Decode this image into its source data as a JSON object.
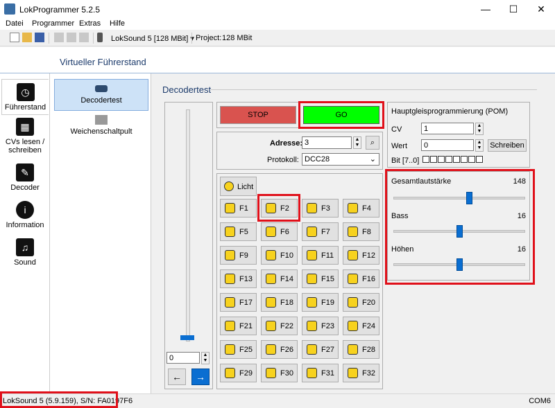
{
  "window": {
    "title": "LokProgrammer 5.2.5",
    "min": "—",
    "max": "☐",
    "close": "✕"
  },
  "menu": [
    "Datei",
    "Programmer",
    "Extras",
    "Hilfe"
  ],
  "toolbar": {
    "device": "LokSound 5 [128 MBit]",
    "project": "Project:",
    "project_value": "128 MBit"
  },
  "header": {
    "title": "Virtueller Führerstand"
  },
  "nav": [
    {
      "label": "Führerstand",
      "icon": "cab-icon"
    },
    {
      "label": "CVs lesen / schreiben",
      "icon": "cv-icon"
    },
    {
      "label": "Decoder",
      "icon": "wrench-icon"
    },
    {
      "label": "Information",
      "icon": "info-icon"
    },
    {
      "label": "Sound",
      "icon": "music-icon"
    }
  ],
  "subnav": [
    {
      "label": "Decodertest"
    },
    {
      "label": "Weichenschaltpult"
    }
  ],
  "section": {
    "title": "Decodertest"
  },
  "control": {
    "stop": "STOP",
    "go": "GO",
    "adresse_label": "Adresse:",
    "adresse": "3",
    "protokoll_label": "Protokoll:",
    "protokoll": "DCC28",
    "licht": "Licht",
    "speed": "0",
    "back_icon": "←",
    "fwd_icon": "→"
  },
  "functions": [
    "F1",
    "F2",
    "F3",
    "F4",
    "F5",
    "F6",
    "F7",
    "F8",
    "F9",
    "F10",
    "F11",
    "F12",
    "F13",
    "F14",
    "F15",
    "F16",
    "F17",
    "F18",
    "F19",
    "F20",
    "F21",
    "F22",
    "F23",
    "F24",
    "F25",
    "F26",
    "F27",
    "F28",
    "F29",
    "F30",
    "F31",
    "F32"
  ],
  "pom": {
    "title": "Hauptgleisprogrammierung (POM)",
    "cv_label": "CV",
    "cv": "1",
    "wert_label": "Wert",
    "wert": "0",
    "schreiben": "Schreiben",
    "bit_label": "Bit [7..0]"
  },
  "volume": {
    "gesamt_label": "Gesamtlautstärke",
    "gesamt": "148",
    "gesamt_level": 0.58,
    "bass_label": "Bass",
    "bass": "16",
    "bass_level": 0.5,
    "hoehen_label": "Höhen",
    "hoehen": "16",
    "hoehen_level": 0.5
  },
  "status": {
    "left": "LokSound 5 (5.9.159), S/N: FA0197F6",
    "right": "COM6"
  },
  "colors": {
    "stop": "#d9534f",
    "go": "#00ff00",
    "highlight": "#e0101a",
    "accent": "#0a6ed1"
  }
}
